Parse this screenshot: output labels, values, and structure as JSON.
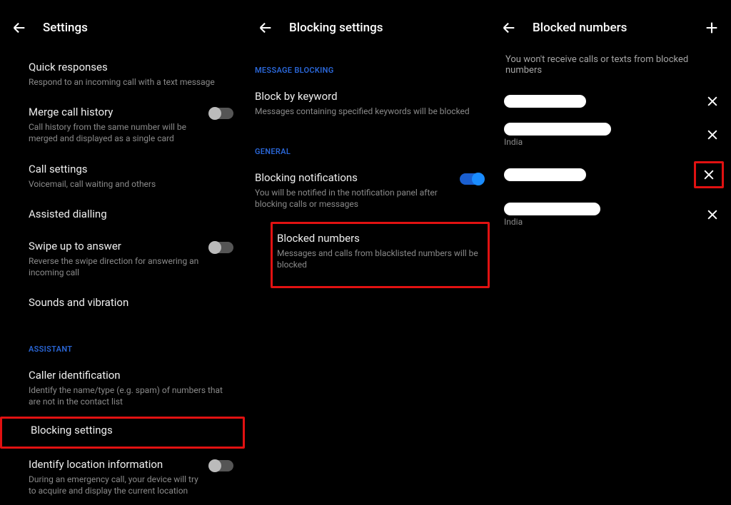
{
  "panel1": {
    "title": "Settings",
    "items": [
      {
        "title": "Quick responses",
        "sub": "Respond to an incoming call with a text message"
      },
      {
        "title": "Merge call history",
        "sub": "Call history from the same number will be merged and displayed as a single card"
      },
      {
        "title": "Call settings",
        "sub": "Voicemail, call waiting and others"
      },
      {
        "title": "Assisted dialling",
        "sub": ""
      },
      {
        "title": "Swipe up to answer",
        "sub": "Reverse the swipe direction for answering an incoming call"
      },
      {
        "title": "Sounds and vibration",
        "sub": ""
      }
    ],
    "section_assistant": "ASSISTANT",
    "assistant_items": [
      {
        "title": "Caller identification",
        "sub": "Identify the name/type (e.g. spam) of numbers that are not in the contact list"
      },
      {
        "title": "Blocking settings",
        "sub": ""
      },
      {
        "title": "Identify location information",
        "sub": "During an emergency call, your device will try to acquire and display the current location"
      }
    ]
  },
  "panel2": {
    "title": "Blocking settings",
    "section_msg": "MESSAGE BLOCKING",
    "msg_items": [
      {
        "title": "Block by keyword",
        "sub": "Messages containing specified keywords will be blocked"
      }
    ],
    "section_general": "GENERAL",
    "general_items": [
      {
        "title": "Blocking notifications",
        "sub": "You will be notified in the notification panel after blocking calls or messages"
      },
      {
        "title": "Blocked numbers",
        "sub": "Messages and calls from blacklisted numbers will be blocked"
      }
    ]
  },
  "panel3": {
    "title": "Blocked numbers",
    "description": "You won't receive calls or texts from blocked numbers",
    "entries": [
      {
        "country": ""
      },
      {
        "country": "India"
      },
      {
        "country": ""
      },
      {
        "country": "India"
      }
    ]
  }
}
